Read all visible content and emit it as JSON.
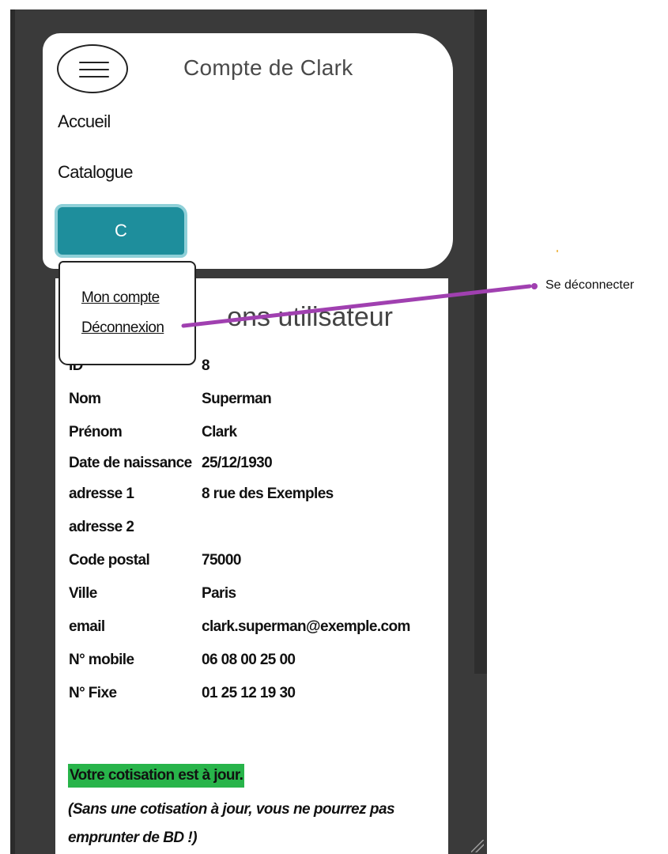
{
  "header": {
    "title": "Compte de Clark",
    "nav": {
      "home": "Accueil",
      "catalog": "Catalogue"
    },
    "user_button": "C"
  },
  "dropdown": {
    "items": [
      "Mon compte",
      "Déconnexion"
    ]
  },
  "content": {
    "title": "ons utilisateur",
    "fields": [
      {
        "label": "ID",
        "value": "8"
      },
      {
        "label": "Nom",
        "value": "Superman"
      },
      {
        "label": "Prénom",
        "value": "Clark"
      },
      {
        "label": "Date de naissance",
        "value": "25/12/1930"
      },
      {
        "label": "adresse 1",
        "value": "8 rue des Exemples"
      },
      {
        "label": "adresse 2",
        "value": ""
      },
      {
        "label": "Code postal",
        "value": "75000"
      },
      {
        "label": "Ville",
        "value": "Paris"
      },
      {
        "label": "email",
        "value": "clark.superman@exemple.com"
      },
      {
        "label": "N° mobile",
        "value": "06 08 00 25 00"
      },
      {
        "label": "N° Fixe",
        "value": "01 25 12 19 30"
      }
    ],
    "status": "Votre cotisation est à jour.",
    "status_note": "(Sans une cotisation à jour, vous ne pourrez pas emprunter de BD !)"
  },
  "annotation": {
    "label": "Se déconnecter"
  },
  "colors": {
    "frame": "#3a3a3a",
    "user_button": "#1e8e9c",
    "user_button_border": "#8fd0d8",
    "status_green": "#28b44a",
    "annotation_purple": "#a040b0"
  },
  "icons": {
    "menu": "hamburger-menu-icon"
  }
}
